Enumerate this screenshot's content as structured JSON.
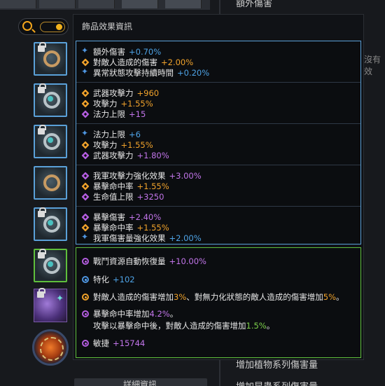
{
  "background": {
    "top_right_text": "額外傷害",
    "bottom_right_text_1": "增加植物系列傷害量",
    "bottom_right_text_2": "增加昆蟲系列傷害量",
    "bottom_button_label": "詳細資訊",
    "side_text": "沒有效"
  },
  "panel": {
    "title": "飾品效果資訊"
  },
  "accessory_groups": [
    {
      "lines": [
        {
          "icon": "star-blue-icon",
          "label": "額外傷害",
          "value": "+0.70%",
          "color": "blue"
        },
        {
          "icon": "diamond-orange-icon",
          "label": "對敵人造成的傷害",
          "value": "+2.00%",
          "color": "orange"
        },
        {
          "icon": "star-blue-icon",
          "label": "異常狀態攻擊持續時間",
          "value": "+0.20%",
          "color": "blue"
        }
      ]
    },
    {
      "lines": [
        {
          "icon": "diamond-orange-icon",
          "label": "武器攻擊力",
          "value": "+960",
          "color": "orange"
        },
        {
          "icon": "diamond-orange-icon",
          "label": "攻擊力",
          "value": "+1.55%",
          "color": "orange"
        },
        {
          "icon": "diamond-purple-icon",
          "label": "法力上限",
          "value": "+15",
          "color": "purple"
        }
      ]
    },
    {
      "lines": [
        {
          "icon": "star-blue-icon",
          "label": "法力上限",
          "value": "+6",
          "color": "blue"
        },
        {
          "icon": "diamond-orange-icon",
          "label": "攻擊力",
          "value": "+1.55%",
          "color": "orange"
        },
        {
          "icon": "diamond-purple-icon",
          "label": "武器攻擊力",
          "value": "+1.80%",
          "color": "purple"
        }
      ]
    },
    {
      "lines": [
        {
          "icon": "diamond-purple-icon",
          "label": "我軍攻擊力強化效果",
          "value": "+3.00%",
          "color": "purple"
        },
        {
          "icon": "diamond-orange-icon",
          "label": "暴擊命中率",
          "value": "+1.55%",
          "color": "orange"
        },
        {
          "icon": "diamond-purple-icon",
          "label": "生命值上限",
          "value": "+3250",
          "color": "purple"
        }
      ]
    },
    {
      "lines": [
        {
          "icon": "diamond-purple-icon",
          "label": "暴擊傷害",
          "value": "+2.40%",
          "color": "purple"
        },
        {
          "icon": "diamond-orange-icon",
          "label": "暴擊命中率",
          "value": "+1.55%",
          "color": "orange"
        },
        {
          "icon": "star-blue-icon",
          "label": "我軍傷害量強化效果",
          "value": "+2.00%",
          "color": "blue"
        }
      ]
    }
  ],
  "set_effects": {
    "e1": {
      "label": "戰鬥資源自動恢復量",
      "value": "+10.00%"
    },
    "e2": {
      "label": "特化",
      "value": "+102"
    },
    "e3": {
      "p1": "對敵人造成的傷害增加",
      "v1": "3%",
      "p2": "、對無力化狀態的敵人造成的傷害增加",
      "v2": "5%",
      "p3": "。"
    },
    "e4": {
      "p1": "暴擊命中率增加",
      "v1": "4.2%",
      "p2": "。",
      "q1": "攻擊以暴擊命中後，對敵人造成的傷害增加",
      "w1": "1.5%",
      "q2": "。"
    },
    "e5": {
      "label": "敏捷",
      "value": "+15744"
    }
  },
  "colors": {
    "blue_value": "#4ea3e6",
    "orange_value": "#f0a22b",
    "purple_value": "#c275ea",
    "blue_border": "#5aa0d8",
    "green_border": "#5fbf3c"
  }
}
